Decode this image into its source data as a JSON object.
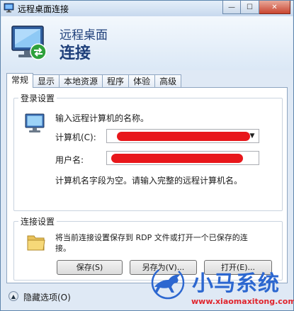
{
  "window": {
    "title": "远程桌面连接",
    "caption": {
      "minimize": "—",
      "maximize": "☐",
      "close": "✕"
    }
  },
  "banner": {
    "line1": "远程桌面",
    "line2": "连接"
  },
  "tabs": [
    {
      "label": "常规",
      "active": true
    },
    {
      "label": "显示"
    },
    {
      "label": "本地资源"
    },
    {
      "label": "程序"
    },
    {
      "label": "体验"
    },
    {
      "label": "高级"
    }
  ],
  "login": {
    "legend": "登录设置",
    "instruction": "输入远程计算机的名称。",
    "computer_label": "计算机(C):",
    "username_label": "用户名:",
    "hint": "计算机名字段为空。请输入完整的远程计算机名。"
  },
  "connection": {
    "legend": "连接设置",
    "description_line1": "将当前连接设置保存到 RDP 文件或打开一个已保存的连",
    "description_line2": "接。",
    "save_label": "保存(S)",
    "save_as_label": "另存为(V)...",
    "open_label": "打开(E)..."
  },
  "footer": {
    "expander_label": "隐藏选项(O)",
    "expander_glyph": "▲"
  },
  "watermark": {
    "brand": "小马系统",
    "url": "www.xiaomaxitong.com"
  },
  "colors": {
    "redaction": "#e8171b",
    "brand_blue": "#2c67d0",
    "brand_red": "#e0242c"
  }
}
